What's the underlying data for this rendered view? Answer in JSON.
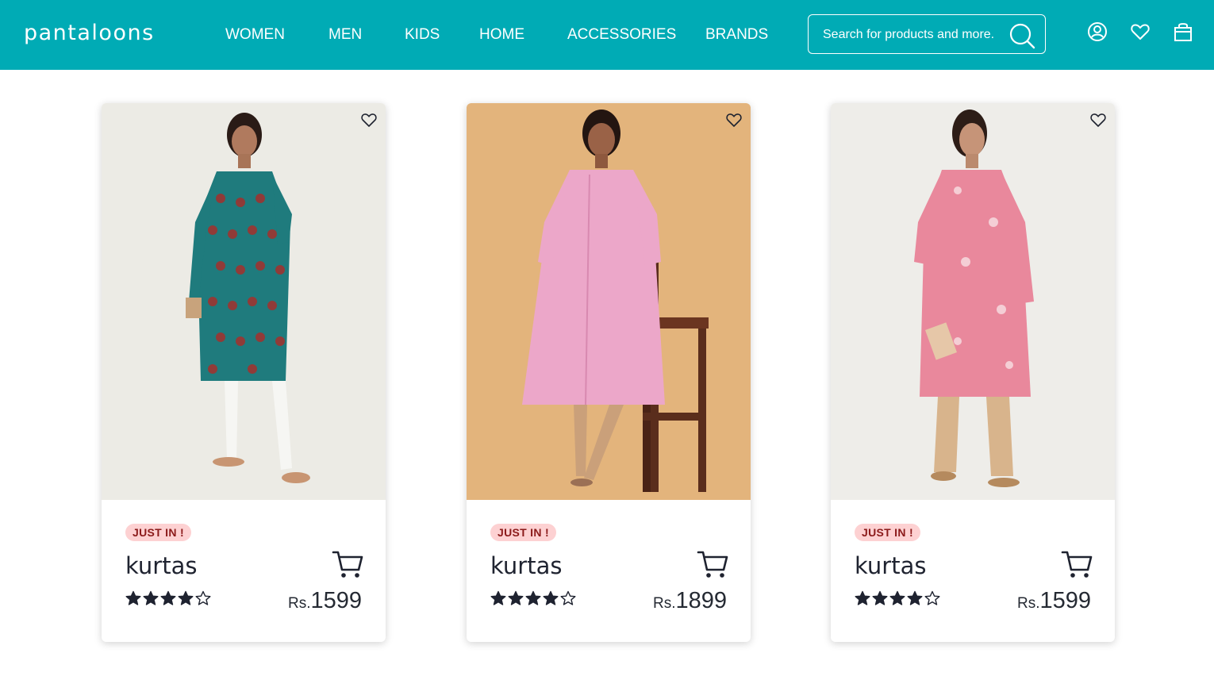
{
  "brand": {
    "logo_text": "pantaloons"
  },
  "nav": {
    "links": [
      "WOMEN",
      "MEN",
      "KIDS",
      "HOME",
      "ACCESSORIES",
      "BRANDS"
    ]
  },
  "search": {
    "placeholder": "Search for products and more."
  },
  "header_icons": [
    "account-icon",
    "wishlist-icon",
    "shopping-bag-icon"
  ],
  "colors": {
    "header_bg": "#00abb5",
    "badge_bg": "#fdd1d2",
    "badge_text": "#8b1a1a"
  },
  "products": [
    {
      "badge": "JUST IN !",
      "title": "kurtas",
      "currency": "Rs.",
      "price": "1599",
      "rating": 4,
      "rating_max": 5,
      "image": "teal printed kurta",
      "bg": "#ecebe5"
    },
    {
      "badge": "JUST IN !",
      "title": "kurtas",
      "currency": "Rs.",
      "price": "1899",
      "rating": 4,
      "rating_max": 5,
      "image": "pink kurta with chair",
      "bg": "#e3b47c"
    },
    {
      "badge": "JUST IN !",
      "title": "kurtas",
      "currency": "Rs.",
      "price": "1599",
      "rating": 4,
      "rating_max": 5,
      "image": "pink embroidered kurta",
      "bg": "#eeede9"
    }
  ]
}
